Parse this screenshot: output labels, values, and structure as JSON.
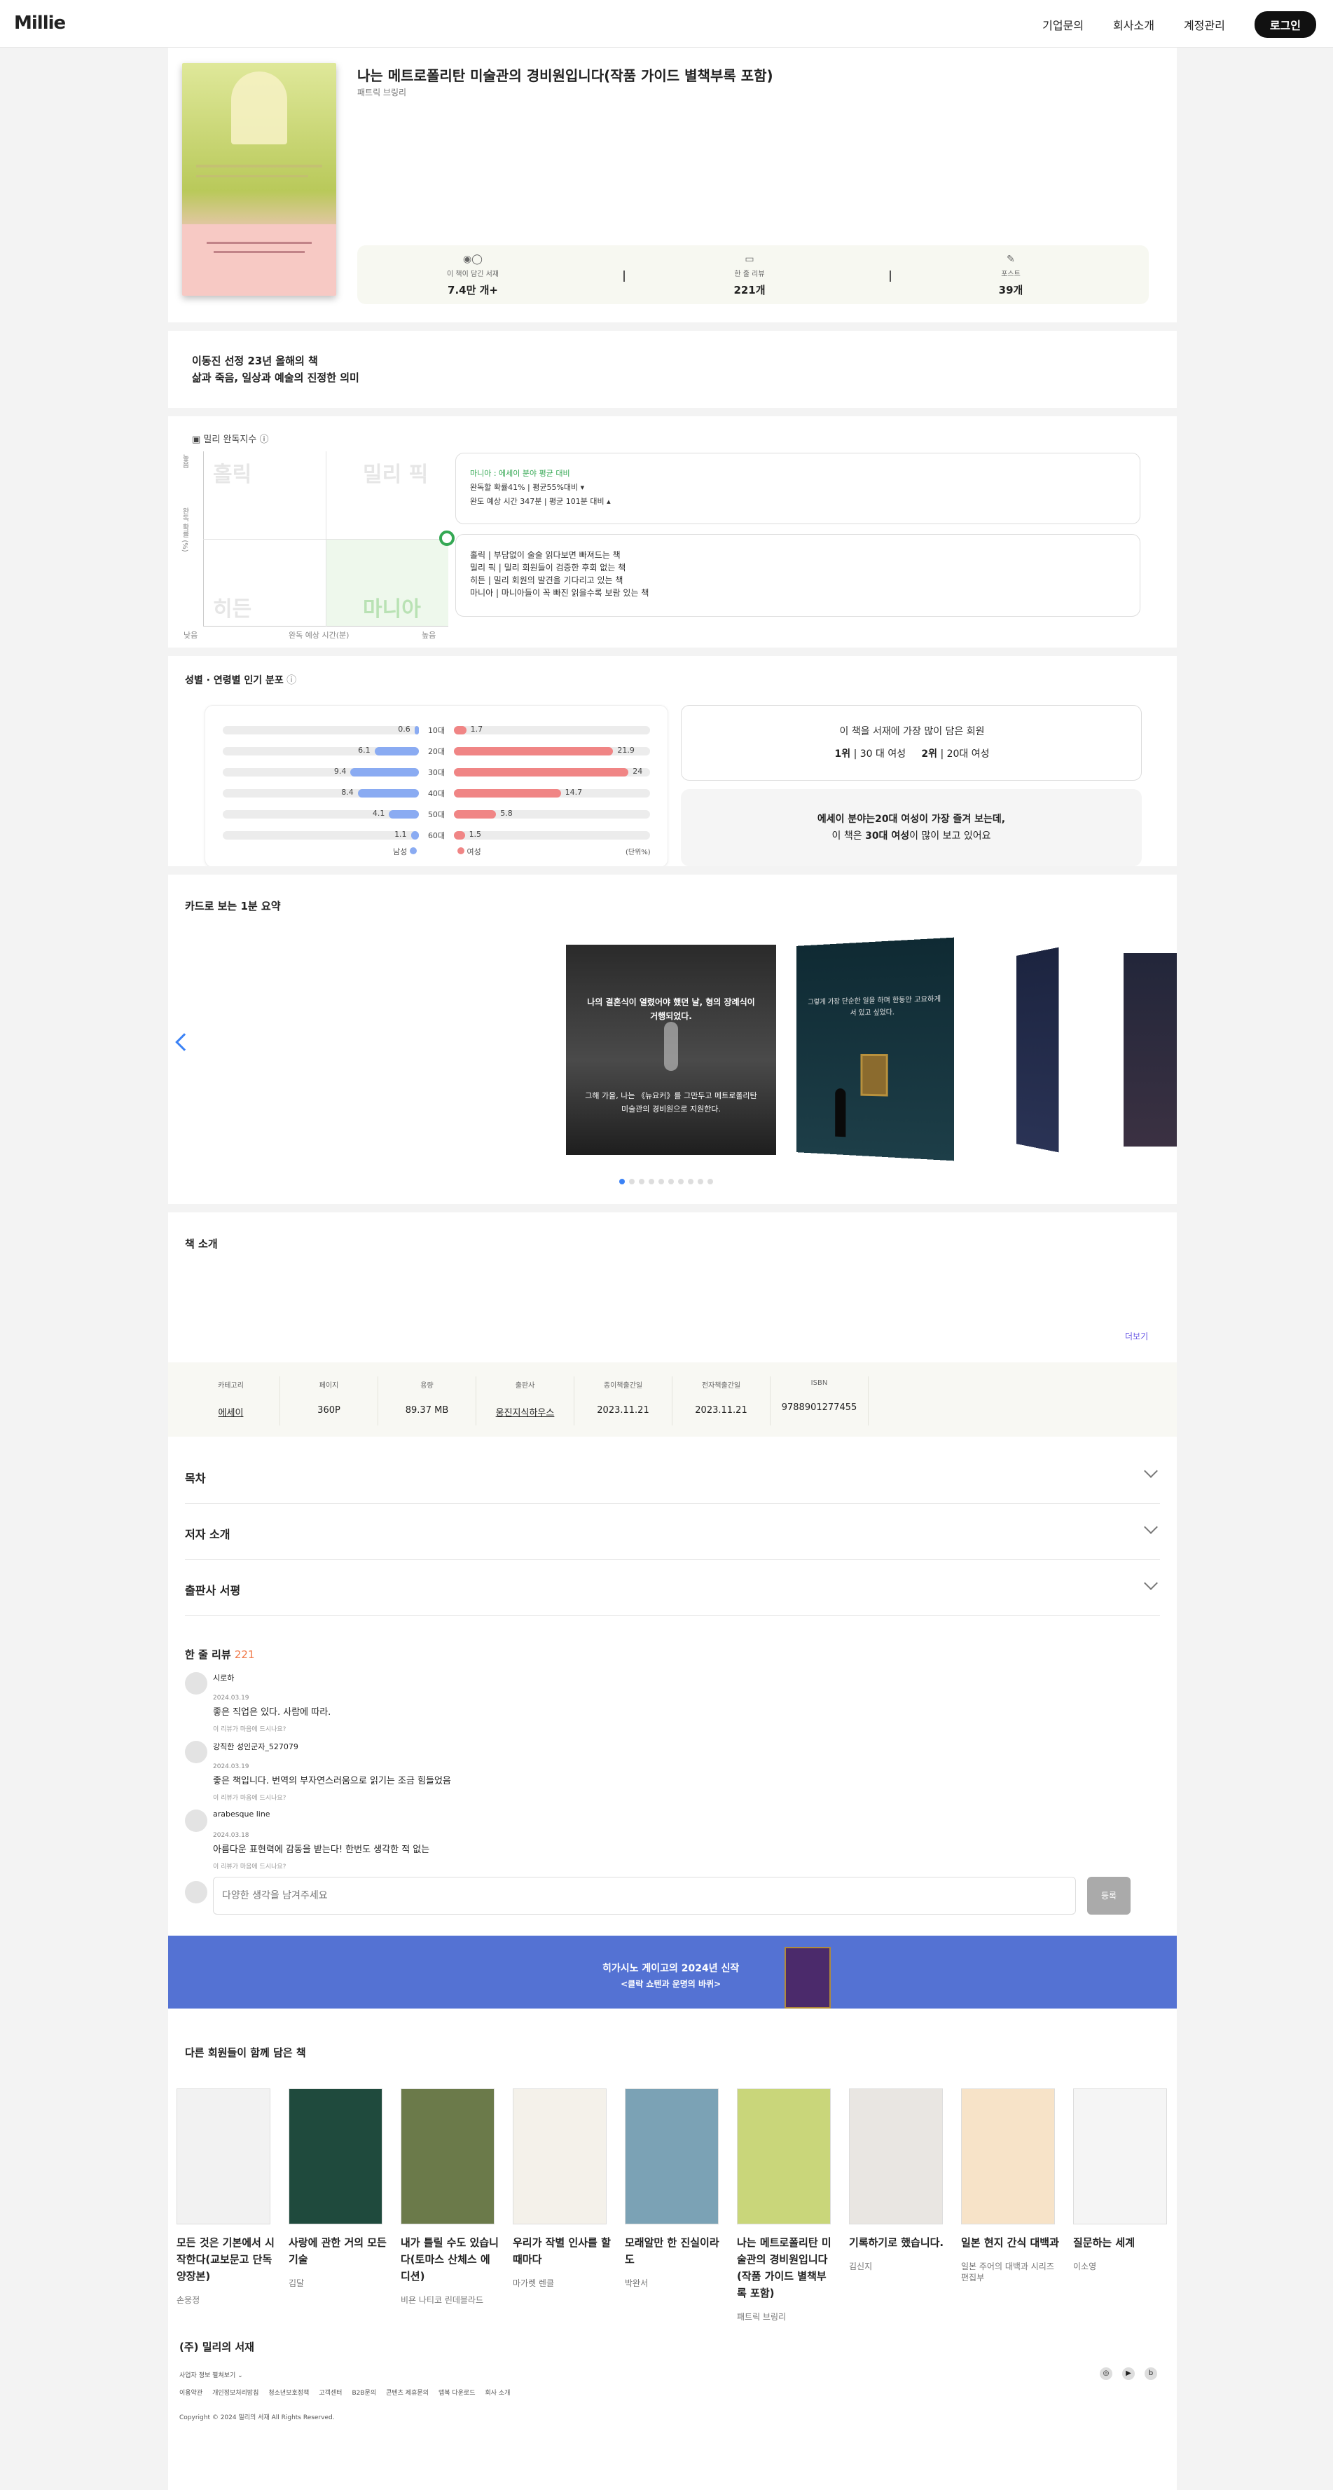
{
  "header": {
    "logo": "Millie",
    "nav": [
      "기업문의",
      "회사소개",
      "계정관리"
    ],
    "login": "로그인"
  },
  "book": {
    "title": "나는 메트로폴리탄 미술관의 경비원입니다(작품 가이드 별책부록 포함)",
    "author": "패트릭 브링리",
    "stats": [
      {
        "icon": "bookshelf-icon",
        "label": "이 책이 담긴 서재",
        "value": "7.4만 개+"
      },
      {
        "icon": "comment-icon",
        "label": "한 줄 리뷰",
        "value": "221개"
      },
      {
        "icon": "edit-icon",
        "label": "포스트",
        "value": "39개"
      }
    ]
  },
  "recommendation": {
    "line1": "이동진 선정 23년 올해의 책",
    "line2": "삶과 죽음, 일상과 예술의 진정한 의미"
  },
  "completion": {
    "title": "밀리 완독지수",
    "quadrants": [
      "홀릭",
      "밀리 픽",
      "히든",
      "마니아"
    ],
    "y_axis": "완독 확률 (%)",
    "y_high": "높음",
    "x_low": "낮음",
    "x_axis": "완독 예상 시간(분)",
    "x_high": "높음",
    "summary_tag": "마니아 : 에세이 분야 평균 대비",
    "summary_line1": "완독할 확률41% | 평균55%대비 ▾",
    "summary_line2": "완도 예상 시간 347분 | 평균 101분 대비 ▴",
    "legend": [
      {
        "name": "홀릭",
        "desc": "부담없이 술술 읽다보면 빠져드는 책"
      },
      {
        "name": "밀리 픽",
        "desc": "밀리 회원들이 검증한 후회 없는 책"
      },
      {
        "name": "히든",
        "desc": "밀리 회원의 발견을 기다리고 있는 책"
      },
      {
        "name": "마니아",
        "desc": "마니아들이 꼭 빠진 읽을수록 보람 있는 책"
      }
    ],
    "accent": "#34a853"
  },
  "demographics": {
    "title": "성별 · 연령별 인기 분포",
    "rows": [
      {
        "age": "10대",
        "male": 0.6,
        "female": 1.7
      },
      {
        "age": "20대",
        "male": 6.1,
        "female": 21.9
      },
      {
        "age": "30대",
        "male": 9.4,
        "female": 24
      },
      {
        "age": "40대",
        "male": 8.4,
        "female": 14.7
      },
      {
        "age": "50대",
        "male": 4.1,
        "female": 5.8
      },
      {
        "age": "60대",
        "male": 1.1,
        "female": 1.5
      }
    ],
    "male_label": "남성",
    "female_label": "여성",
    "unit": "(단위%)",
    "most_title": "이 책을 서재에 가장 많이 담은 회원",
    "rank1": "1위",
    "rank1_text": "| 30 대 여성",
    "rank2": "2위",
    "rank2_text": "| 20대 여성",
    "insight_l1": "에세이 분야는20대 여성이 가장 즐겨 보는데,",
    "insight_l2_a": "이 책은 ",
    "insight_l2_b": "30대 여성",
    "insight_l2_c": "이 많이 보고 있어요",
    "male_color": "#8aabf2",
    "female_color": "#f08585"
  },
  "cards": {
    "title": "카드로 보는 1분 요약",
    "card1_top": "나의 결혼식이 열렸어야 했던 날, 형의 장례식이 거행되었다.",
    "card1_bottom": "그해 가을, 나는 《뉴요커》를 그만두고 메트로폴리탄 미술관의 경비원으로 지원한다.",
    "card2_top": "그렇게 가장 단순한 일을 하며 한동안 고요하게 서 있고 싶었다.",
    "dots": 10
  },
  "intro": {
    "title": "책 소개",
    "more": "더보기"
  },
  "info": {
    "headers": [
      "카테고리",
      "페이지",
      "용량",
      "출판사",
      "종이책출간일",
      "전자책출간일",
      "ISBN"
    ],
    "values": [
      "에세이",
      "360P",
      "89.37 MB",
      "웅진지식하우스",
      "2023.11.21",
      "2023.11.21",
      "9788901277455"
    ]
  },
  "accordions": [
    "목차",
    "저자 소개",
    "출판사 서평"
  ],
  "reviews": {
    "title": "한 줄 리뷰",
    "count": "221",
    "items": [
      {
        "name": "시로하",
        "date": "2024.03.19",
        "text": "좋은 직업은 있다. 사람에 따라.",
        "reply": "이 리뷰가 마음에 드시나요?"
      },
      {
        "name": "강직한 성인군자_527079",
        "date": "2024.03.19",
        "text": "좋은 책입니다. 번역의 부자연스러움으로 읽기는 조금 힘들었음",
        "reply": "이 리뷰가 마음에 드시나요?"
      },
      {
        "name": "arabesque line",
        "date": "2024.03.18",
        "text": "아름다운 표현력에 감동을 받는다! 한번도 생각한 적 없는",
        "reply": "이 리뷰가 마음에 드시나요?"
      }
    ],
    "placeholder": "다양한 생각을 남겨주세요",
    "submit": "등록"
  },
  "banner": {
    "line1": "히가시노 게이고의 2024년 신작",
    "line2": "<클락 쇼텐과 운명의 바퀴>",
    "color": "#5472d3"
  },
  "also_read": {
    "title": "다른 회원들이 함께 담은 책",
    "books": [
      {
        "title": "모든 것은 기본에서 시작한다(교보문고 단독 양장본)",
        "author": "손웅정",
        "color": "#f2f2f2"
      },
      {
        "title": "사랑에 관한 거의 모든 기술",
        "author": "김달",
        "color": "#1f4a3d"
      },
      {
        "title": "내가 틀릴 수도 있습니다(토마스 산체스 에디션)",
        "author": "비욘 나티코 린데블라드",
        "color": "#6b7a4a"
      },
      {
        "title": "우리가 작별 인사를 할 때마다",
        "author": "마가렛 렌클",
        "color": "#f4f1ea"
      },
      {
        "title": "모래알만 한 진실이라도",
        "author": "박완서",
        "color": "#7ba2b5"
      },
      {
        "title": "나는 메트로폴리탄 미술관의 경비원입니다(작품 가이드 별책부록 포함)",
        "author": "패트릭 브링리",
        "color": "#c9d67a"
      },
      {
        "title": "기록하기로 했습니다.",
        "author": "김신지",
        "color": "#e9e6e2"
      },
      {
        "title": "일본 현지 간식 대백과",
        "author": "일본 주어의 대백과 시리즈 편집부",
        "color": "#f7e3c8"
      },
      {
        "title": "질문하는 세계",
        "author": "이소영",
        "color": "#f5f5f5"
      }
    ]
  },
  "footer": {
    "company": "(주) 밀리의 서재",
    "info_toggle": "사업자 정보 펼쳐보기",
    "links": [
      "이용약관",
      "개인정보처리방침",
      "청소년보호정책",
      "고객센터",
      "B2B문의",
      "콘텐츠 제휴문의",
      "앱북 다운로드",
      "회사 소개"
    ],
    "copyright": "Copyright © 2024 밀리의 서재 All Rights Reserved.",
    "social": [
      "instagram-icon",
      "youtube-icon",
      "blog-icon"
    ]
  }
}
